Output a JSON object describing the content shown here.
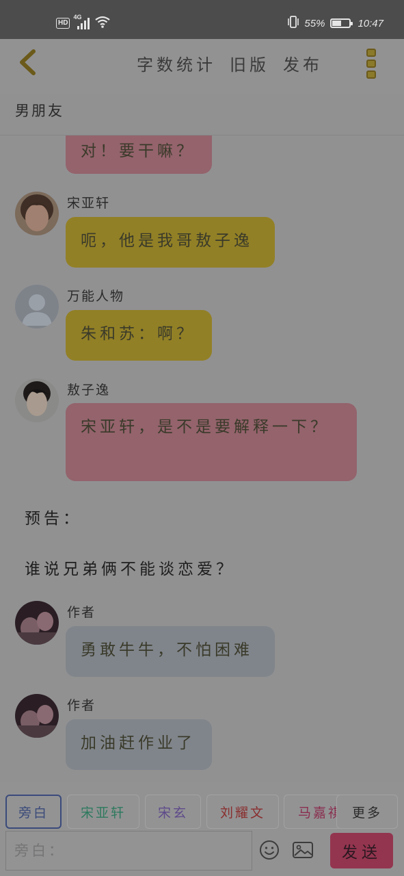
{
  "status_bar": {
    "hd_label": "HD",
    "network_label": "4G",
    "battery_percent": "55%",
    "battery_level": 0.55,
    "time": "10:47"
  },
  "header": {
    "back_icon": "chevron-left-icon",
    "actions": [
      "字数统计",
      "旧版",
      "发布"
    ],
    "more_icon": "more-vertical-icon",
    "story_title": "男朋友"
  },
  "messages": [
    {
      "sender": "",
      "text": "对！要干嘛？",
      "color": "pink",
      "avatar": "photo-avatar-partial"
    },
    {
      "sender": "宋亚轩",
      "text": "呃，他是我哥敖子逸",
      "color": "gold",
      "avatar": "boy-photo-avatar"
    },
    {
      "sender": "万能人物",
      "text": "朱和苏：啊？",
      "color": "gold",
      "avatar": "default-person-avatar"
    },
    {
      "sender": "敖子逸",
      "text": "宋亚轩，是不是要解释一下？",
      "color": "pink",
      "avatar": "boy-photo-avatar-2"
    },
    {
      "narration": "预告："
    },
    {
      "narration": "谁说兄弟俩不能谈恋爱？"
    },
    {
      "sender": "作者",
      "text": "勇敢牛牛，不怕困难",
      "color": "gray",
      "avatar": "author-photo-avatar"
    },
    {
      "sender": "作者",
      "text": "加油赶作业了",
      "color": "gray",
      "avatar": "author-photo-avatar"
    }
  ],
  "role_chips": [
    {
      "label": "旁白",
      "color": "#3a4a7a",
      "active": true
    },
    {
      "label": "宋亚轩",
      "color": "#2e7a5e"
    },
    {
      "label": "宋玄",
      "color": "#5e4a8a"
    },
    {
      "label": "刘耀文",
      "color": "#8a2e2e"
    },
    {
      "label": "马嘉祺",
      "color": "#8a2e4e"
    },
    {
      "label": "更多",
      "color": "#2a2a2a"
    }
  ],
  "composer": {
    "placeholder": "旁白：",
    "emoji_icon": "smiley-icon",
    "image_icon": "image-icon",
    "send_label": "发送"
  },
  "colors": {
    "bubble_pink": "#94636c",
    "bubble_gold": "#928026",
    "bubble_gray": "#80858b",
    "send_button": "#93354f"
  }
}
